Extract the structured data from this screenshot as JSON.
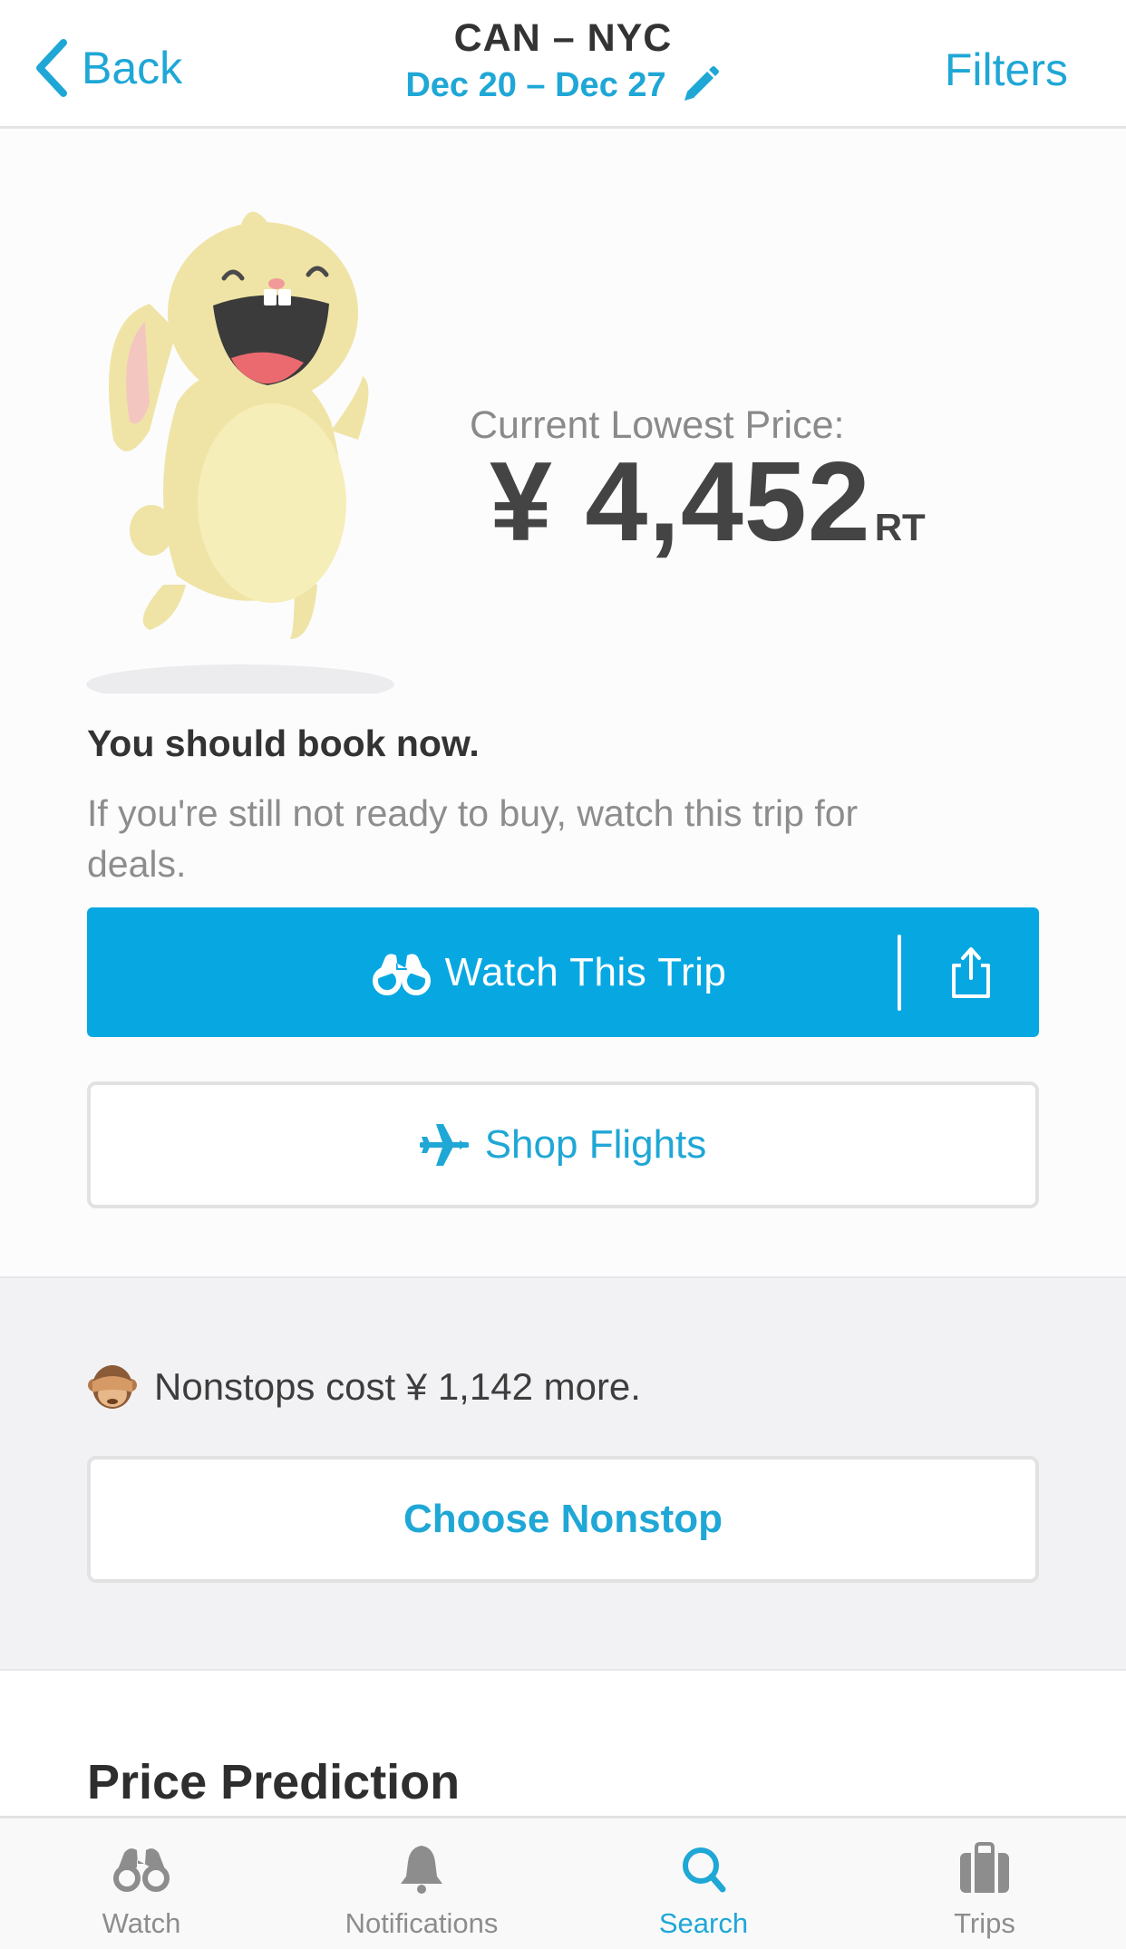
{
  "nav": {
    "back_label": "Back",
    "route": "CAN – NYC",
    "dates": "Dec 20 – Dec 27",
    "filters_label": "Filters"
  },
  "hero": {
    "price_label": "Current Lowest Price:",
    "price": "¥ 4,452",
    "price_suffix": "RT",
    "advice_title": "You should book now.",
    "advice_subtitle": "If you're still not ready to buy, watch this trip for deals."
  },
  "actions": {
    "watch_label": "Watch This Trip",
    "shop_label": "Shop Flights"
  },
  "nonstop": {
    "text": "Nonstops cost  ¥ 1,142 more.",
    "choose_label": "Choose Nonstop"
  },
  "prediction": {
    "title": "Price Prediction"
  },
  "tabs": [
    {
      "label": "Watch",
      "icon": "binoculars-icon",
      "active": false
    },
    {
      "label": "Notifications",
      "icon": "bell-icon",
      "active": false
    },
    {
      "label": "Search",
      "icon": "search-icon",
      "active": true
    },
    {
      "label": "Trips",
      "icon": "suitcase-icon",
      "active": false
    }
  ],
  "colors": {
    "accent": "#1fa7d6",
    "watch_button": "#07a8e2",
    "inactive_tab": "#8d8d8d"
  }
}
